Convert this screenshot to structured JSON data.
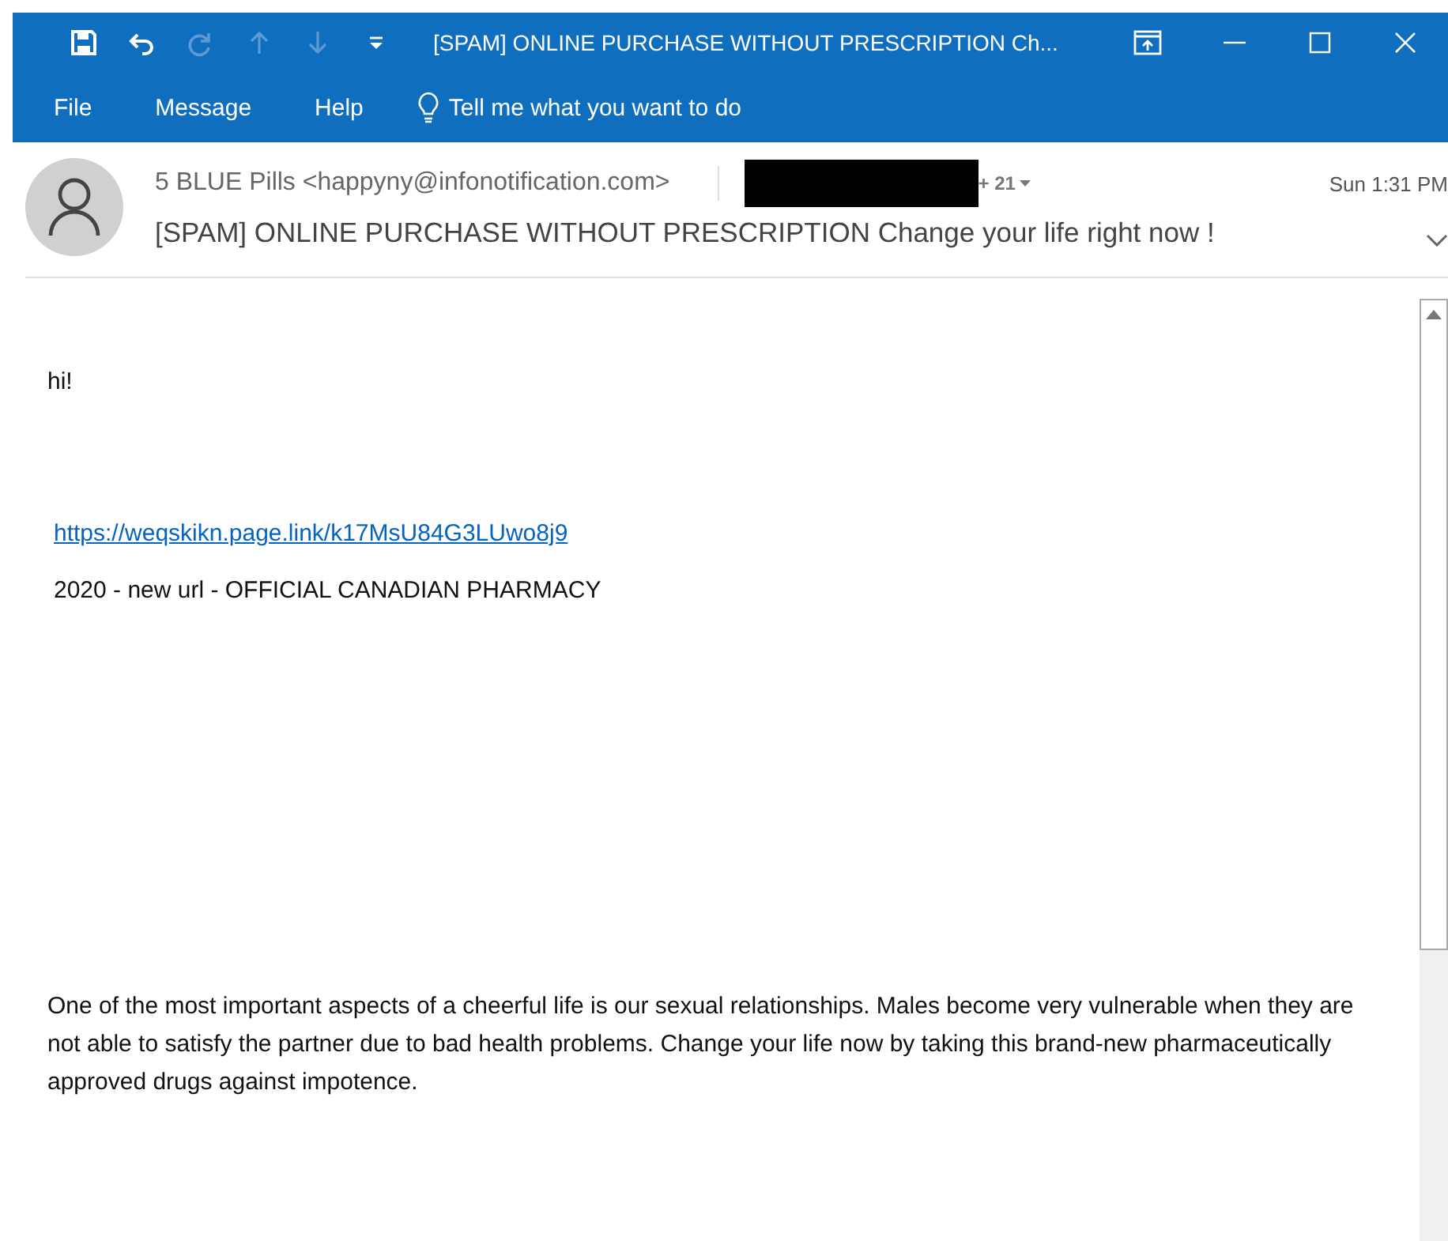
{
  "window": {
    "title": "[SPAM] ONLINE PURCHASE WITHOUT PRESCRIPTION Ch...",
    "quick_access": [
      {
        "kind": "save",
        "disabled": false
      },
      {
        "kind": "undo",
        "disabled": false
      },
      {
        "kind": "redo",
        "disabled": true
      },
      {
        "kind": "up",
        "disabled": true
      },
      {
        "kind": "down",
        "disabled": true
      },
      {
        "kind": "customize",
        "disabled": false
      }
    ]
  },
  "menu": {
    "items": [
      {
        "label": "File"
      },
      {
        "label": "Message"
      },
      {
        "label": "Help"
      }
    ],
    "search": {
      "placeholder": "Tell me what you want to do"
    }
  },
  "header": {
    "sender": "5 BLUE Pills <happyny@infonotification.com>",
    "recipients_redacted": true,
    "more_recipients": "+ 21",
    "date": "Sun 1:31 PM",
    "subject": "[SPAM] ONLINE PURCHASE WITHOUT PRESCRIPTION Change your life right now !"
  },
  "body": {
    "greeting": "hi!",
    "link": "https://weqskikn.page.link/k17MsU84G3LUwo8j9",
    "tagline": "2020 - new url - OFFICIAL CANADIAN PHARMACY",
    "paragraph": "One of the most important aspects of a cheerful life is our sexual relationships. Males become very vulnerable when they are not able to satisfy the partner due to bad health problems. Change your life now by taking this brand-new pharmaceutically approved drugs against impotence."
  }
}
